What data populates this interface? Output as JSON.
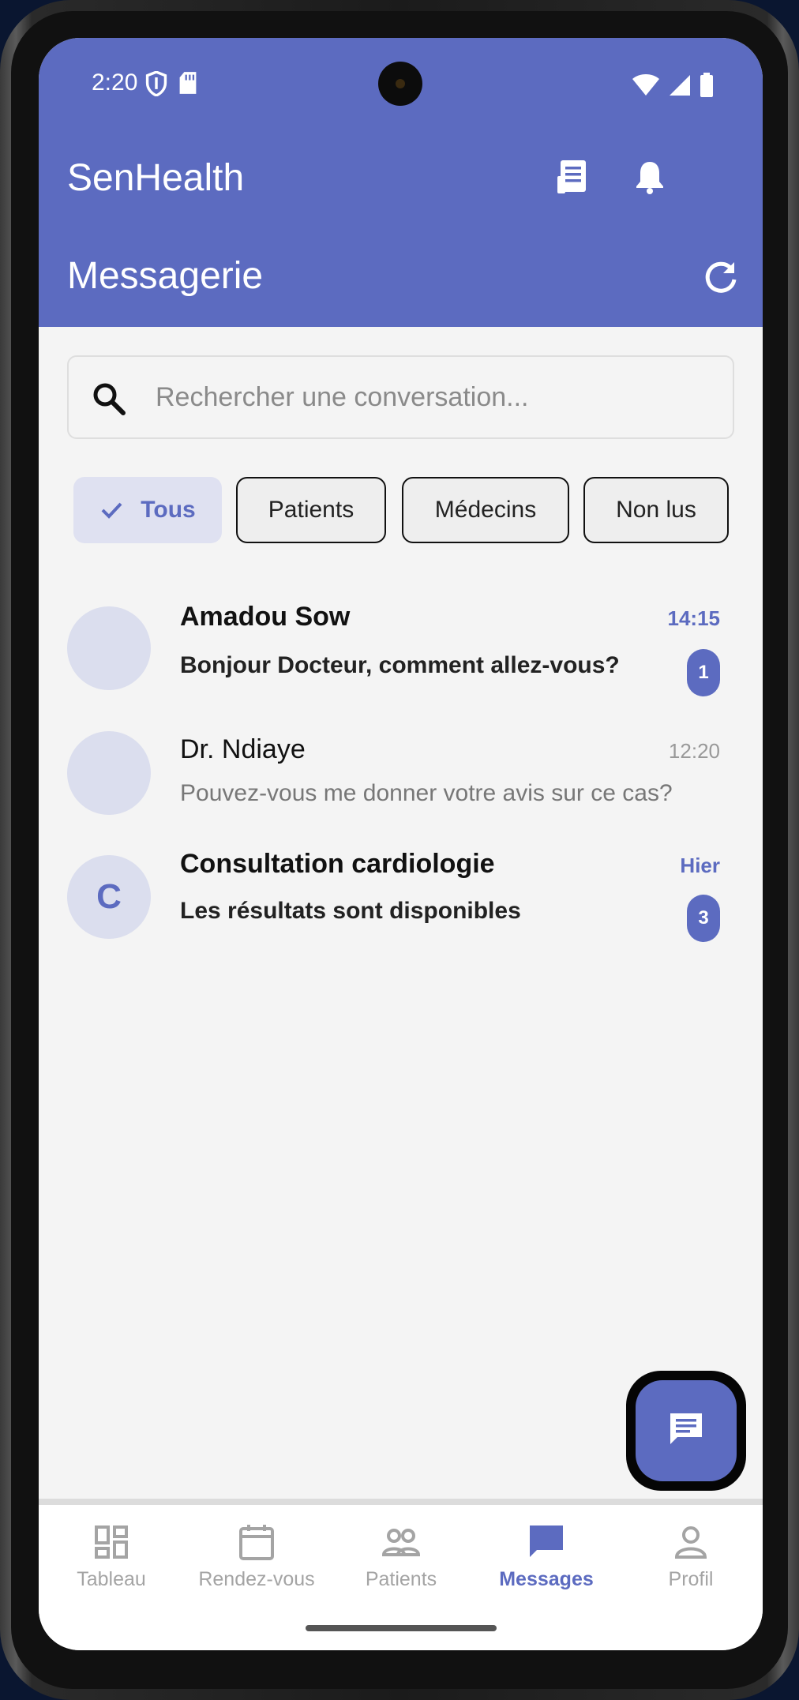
{
  "status_bar": {
    "time": "2:20"
  },
  "app": {
    "title": "SenHealth",
    "page_title": "Messagerie"
  },
  "search": {
    "placeholder": "Rechercher une conversation..."
  },
  "filters": [
    {
      "label": "Tous",
      "selected": true
    },
    {
      "label": "Patients",
      "selected": false
    },
    {
      "label": "Médecins",
      "selected": false
    },
    {
      "label": "Non lus",
      "selected": false
    }
  ],
  "conversations": [
    {
      "name": "Amadou Sow",
      "message": "Bonjour Docteur, comment allez-vous?",
      "time": "14:15",
      "unread": true,
      "badge": "1",
      "avatar_letter": ""
    },
    {
      "name": "Dr. Ndiaye",
      "message": "Pouvez-vous me donner votre avis sur ce cas?",
      "time": "12:20",
      "unread": false,
      "badge": "",
      "avatar_letter": ""
    },
    {
      "name": "Consultation cardiologie",
      "message": "Les résultats sont disponibles",
      "time": "Hier",
      "unread": true,
      "badge": "3",
      "avatar_letter": "C"
    }
  ],
  "bottom_nav": [
    {
      "label": "Tableau",
      "icon": "dashboard-icon",
      "active": false
    },
    {
      "label": "Rendez-vous",
      "icon": "calendar-icon",
      "active": false
    },
    {
      "label": "Patients",
      "icon": "people-icon",
      "active": false
    },
    {
      "label": "Messages",
      "icon": "chat-icon",
      "active": true
    },
    {
      "label": "Profil",
      "icon": "person-icon",
      "active": false
    }
  ],
  "colors": {
    "primary": "#5c6bc0",
    "background": "#f4f4f4",
    "chip_selected_bg": "#dfe1f1"
  }
}
